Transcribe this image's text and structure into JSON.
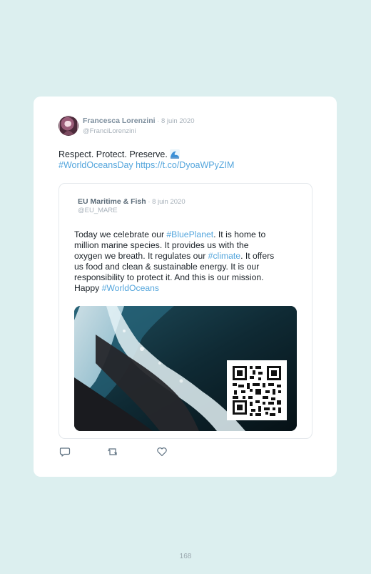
{
  "tweet": {
    "author_name": "Francesca Lorenzini",
    "date": " · 8 juin 2020",
    "handle": "@FranciLorenzini",
    "text": "Respect. Protect. Preserve. ",
    "hashtag": "#WorldOceansDay",
    "link": " https://t.co/DyoaWPyZIM",
    "emoji_icon": "wave-icon"
  },
  "quoted_tweet": {
    "author_name": "EU Maritime & Fish",
    "date": " · 8 juin 2020",
    "handle": "@EU_MARE",
    "line1_a": "Today we celebrate our ",
    "line1_tag": "#BluePlanet",
    "line1_b": ". It is home to",
    "line2": "million marine species. It provides us with the",
    "line3_a": "oxygen we breath. It regulates our ",
    "line3_tag": "#climate",
    "line3_b": ". It offers",
    "line4": "us food and clean & sustainable energy. It is our",
    "line5": "responsibility to protect it. And this is our mission.",
    "line6_a": "Happy ",
    "line6_tag": "#WorldOceans",
    "media_icon": "ocean-wave-photo",
    "qr_icon": "qr-code"
  },
  "actions": [
    "reply-icon",
    "retweet-icon",
    "like-icon"
  ],
  "colors": {
    "background": "#dcefef",
    "link": "#53a5dc",
    "card": "#ffffff"
  },
  "page_number": "168"
}
